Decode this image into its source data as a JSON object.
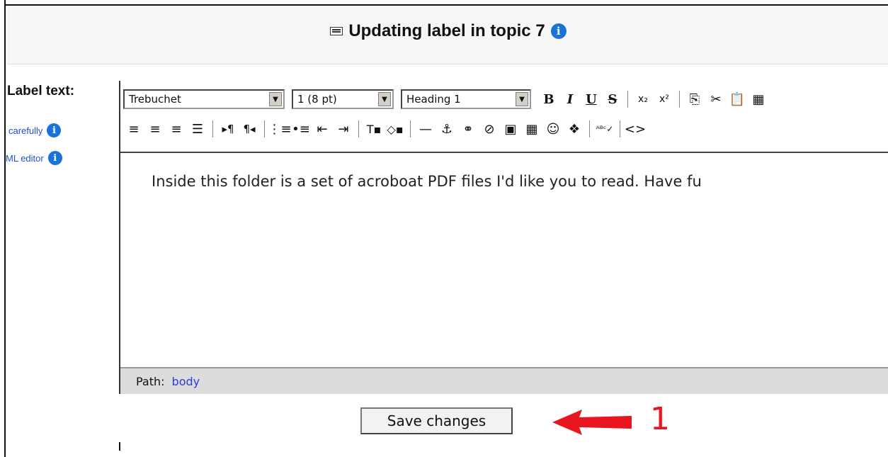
{
  "header": {
    "title": "Updating label in topic 7",
    "icon": "label-icon",
    "help_icon": "info-icon"
  },
  "form": {
    "label_text": "Label text:",
    "help_links": [
      {
        "text": "carefully",
        "icon": "info-icon"
      },
      {
        "text": "ML editor",
        "icon": "info-icon"
      }
    ]
  },
  "editor": {
    "font_select": "Trebuchet",
    "size_select": "1 (8 pt)",
    "format_select": "Heading 1",
    "content": "Inside this folder is a set of acroboat PDF files I'd like you to read. Have fu",
    "path_label": "Path:",
    "path_value": "body"
  },
  "actions": {
    "save_label": "Save changes"
  },
  "annotation": {
    "number": "1",
    "color": "#e8141e"
  }
}
